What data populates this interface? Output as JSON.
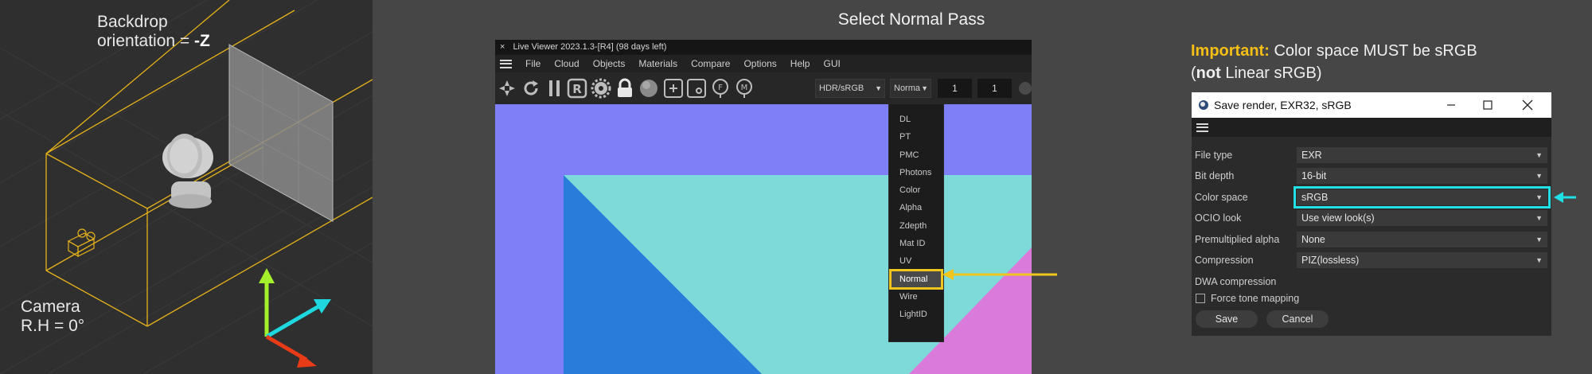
{
  "left": {
    "backdrop_line1": "Backdrop",
    "backdrop_line2_prefix": "orientation = ",
    "backdrop_line2_value": "-Z",
    "camera_line1": "Camera",
    "camera_line2": "R.H = 0°"
  },
  "middle": {
    "title": "Select Normal Pass",
    "live_viewer": {
      "close_glyph": "×",
      "title": "Live Viewer 2023.1.3-[R4] (98 days left)",
      "menu": [
        "File",
        "Cloud",
        "Objects",
        "Materials",
        "Compare",
        "Options",
        "Help",
        "GUI"
      ],
      "toolbar_letters": {
        "r": "R",
        "f": "F",
        "m": "M"
      },
      "colorspace_value": "HDR/sRGB",
      "pass_value": "Norma",
      "spin1": "1",
      "spin2": "1"
    },
    "pass_menu": {
      "items": [
        "DL",
        "PT",
        "PMC",
        "Photons",
        "Color",
        "Alpha",
        "Zdepth",
        "Mat ID",
        "UV",
        "Normal",
        "Wire",
        "LightID"
      ],
      "selected": "Normal"
    },
    "colors": {
      "arrow": "#f0c51e",
      "bg_blue": "#7f7ff8",
      "cyan": "#7ddad9",
      "blue": "#2a7cdb",
      "pink": "#da7bdb"
    }
  },
  "right": {
    "important_kw": "Important:",
    "important_text": " Color space MUST be sRGB",
    "not_open": "(",
    "not_word": "not",
    "not_rest": " Linear sRGB)",
    "save_render": {
      "title": "Save render, EXR32, sRGB",
      "rows": [
        {
          "label": "File type",
          "value": "EXR"
        },
        {
          "label": "Bit depth",
          "value": "16-bit"
        },
        {
          "label": "Color space",
          "value": "sRGB"
        },
        {
          "label": "OCIO look",
          "value": "Use view look(s)"
        },
        {
          "label": "Premultiplied alpha",
          "value": "None"
        },
        {
          "label": "Compression",
          "value": "PIZ(lossless)"
        }
      ],
      "dwa_label": "DWA compression",
      "force_tone_mapping": "Force tone mapping",
      "save_button": "Save",
      "cancel_button": "Cancel"
    },
    "colors": {
      "highlight": "#1fe0e4",
      "important": "#f5bf16"
    }
  }
}
